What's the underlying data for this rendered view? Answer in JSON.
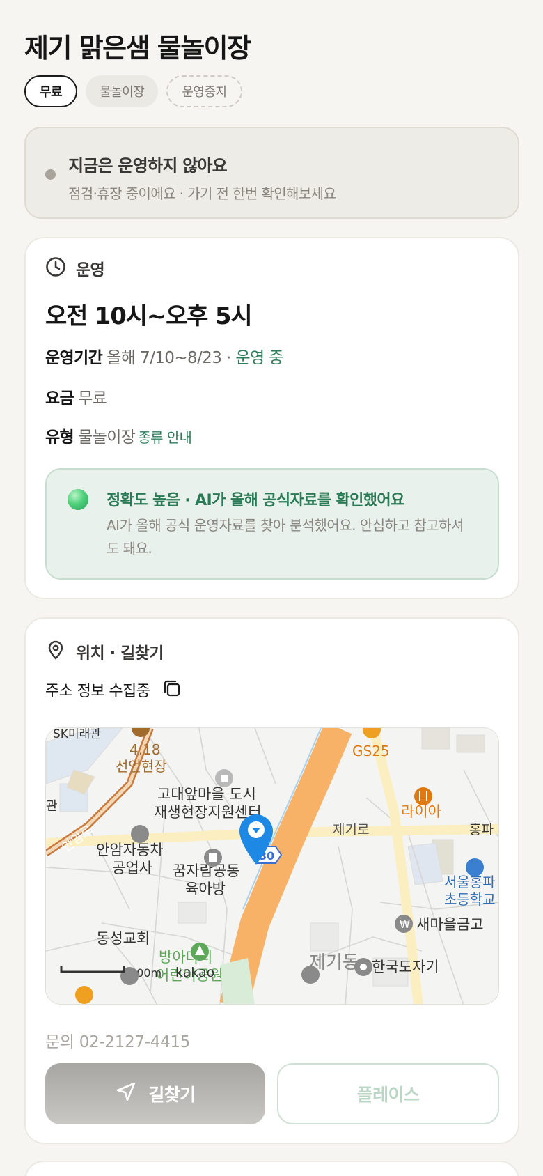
{
  "title": "제기 맑은샘 물놀이장",
  "chips": {
    "free": "무료",
    "type": "물놀이장",
    "status": "운영중지"
  },
  "notice": {
    "title": "지금은 운영하지 않아요",
    "subtitle": "점검·휴장 중이에요 · 가기 전 한번 확인해보세요"
  },
  "hours": {
    "section_label": "운영",
    "time": "오전 10시~오후 5시",
    "period_label": "운영기간",
    "period_value": "올해 7/10~8/23 ·",
    "period_status": "운영 중",
    "fee_label": "요금",
    "fee_value": "무료",
    "type_label": "유형",
    "type_value": "물놀이장",
    "type_link": "종류 안내",
    "accuracy_title": "정확도 높음 · AI가 올해 공식자료를 확인했어요",
    "accuracy_body": "AI가 올해 공식 운영자료를 찾아 분석했어요. 안심하고 참고하셔도 돼요."
  },
  "location": {
    "section_label": "위치 · 길찾기",
    "address": "주소 정보 수집중",
    "map_labels": {
      "sk": "SK미래관",
      "monument_a": "4.18",
      "monument_b": "선언현장",
      "gs25": "GS25",
      "center_a": "고대앞마을 도시",
      "center_b": "재생현장지원센터",
      "raia": "라이아",
      "anamro": "안암로",
      "gwan": "관",
      "jegiro": "제기로",
      "hongpa": "홍파",
      "repair_a": "안암자동차",
      "repair_b": "공업사",
      "nursery_a": "꿈자람공동",
      "nursery_b": "육아방",
      "road_num": "30",
      "school_a": "서울홍파",
      "school_b": "초등학교",
      "bank": "새마을금고",
      "church": "동성교회",
      "park_a": "방아다리",
      "park_b": "어린이공원",
      "district": "제기동",
      "photo": "한국도자기",
      "scale": "100m",
      "brand": "kakao"
    },
    "contact": "문의 02-2127-4415",
    "route_button": "길찾기",
    "place_button": "플레이스"
  },
  "colors": {
    "accent_green": "#2e7d5b",
    "pin_blue": "#1e88e5",
    "road_orange": "#f7b267"
  }
}
